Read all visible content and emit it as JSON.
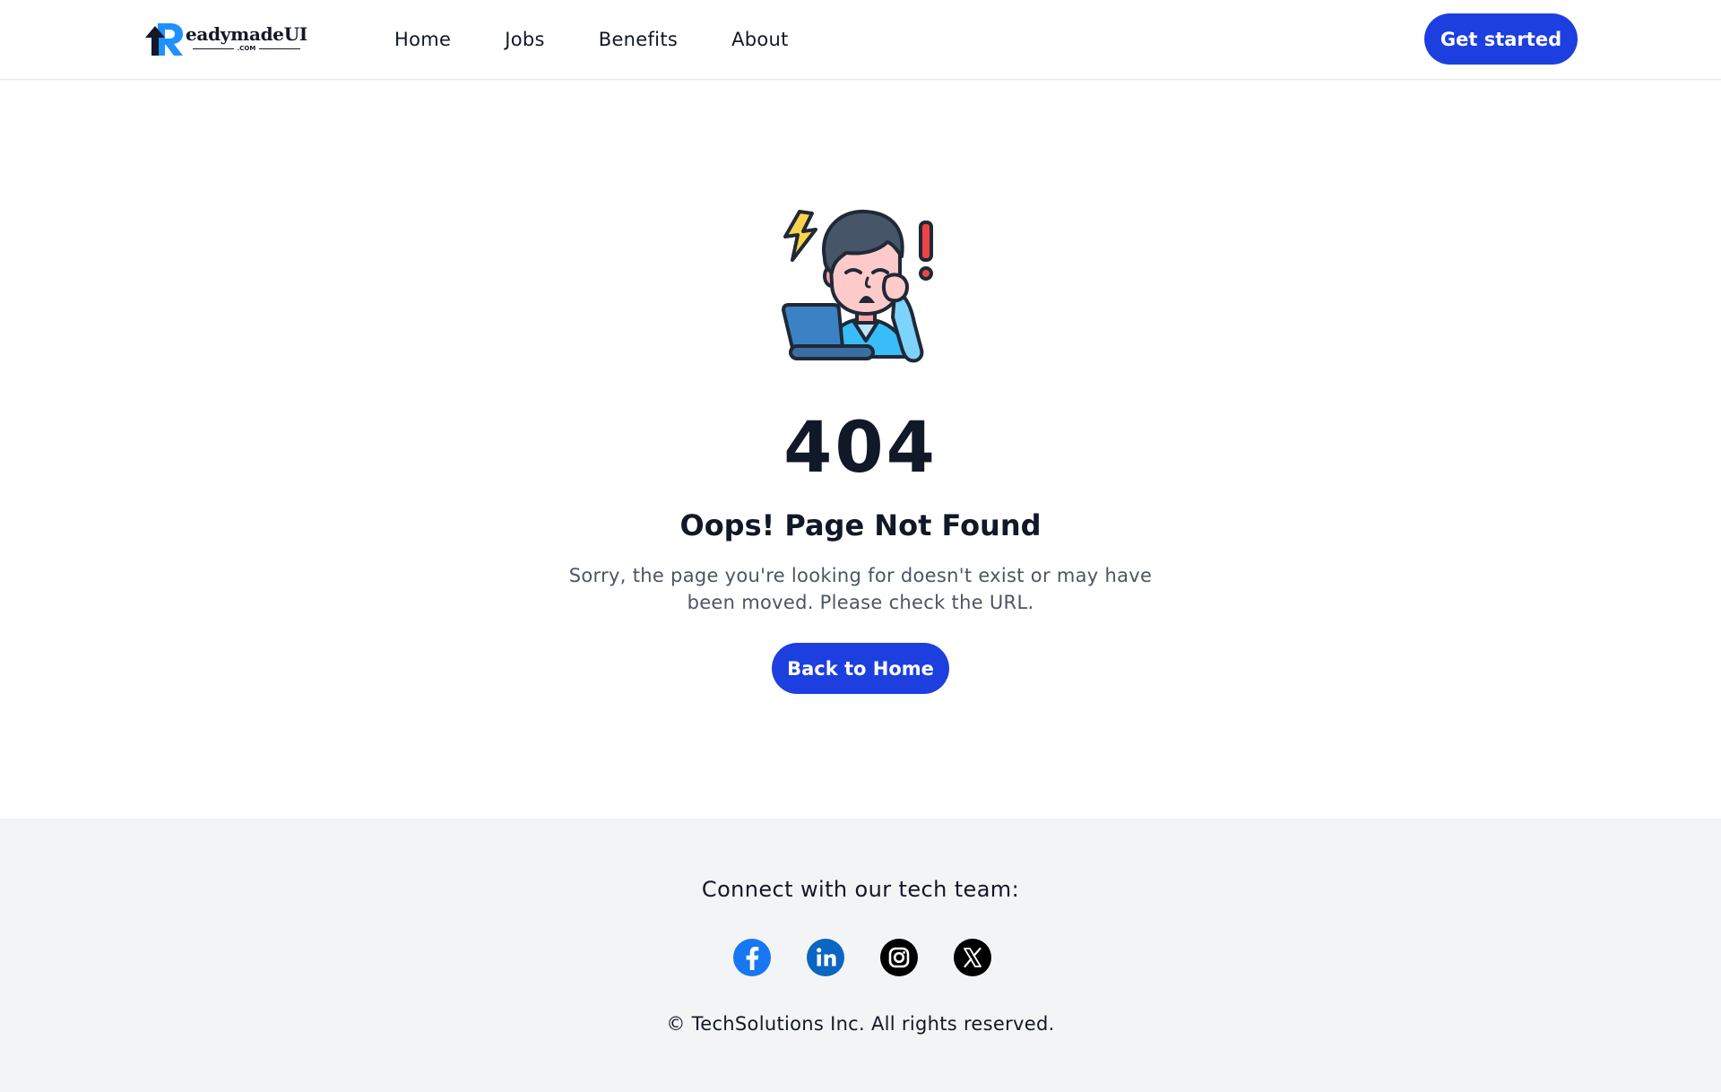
{
  "header": {
    "logo": {
      "brand": "ReadymadeUI",
      "word": "eadymadeUI",
      "sub": ".COM"
    },
    "nav": [
      {
        "label": "Home"
      },
      {
        "label": "Jobs"
      },
      {
        "label": "Benefits"
      },
      {
        "label": "About"
      }
    ],
    "cta_label": "Get started"
  },
  "main": {
    "illustration_icon": "frustrated-person-laptop-icon",
    "code": "404",
    "title": "Oops! Page Not Found",
    "description": "Sorry, the page you're looking for doesn't exist or may have been moved. Please check the URL.",
    "button_label": "Back to Home"
  },
  "footer": {
    "title": "Connect with our tech team:",
    "socials": [
      {
        "icon": "facebook-icon",
        "color": "#1877f2"
      },
      {
        "icon": "linkedin-icon",
        "color": "#0a66c2"
      },
      {
        "icon": "instagram-icon",
        "color": "#000000"
      },
      {
        "icon": "x-icon",
        "color": "#000000"
      }
    ],
    "copyright": "© TechSolutions Inc. All rights reserved."
  },
  "colors": {
    "accent": "#1d3fe0",
    "text": "#111827",
    "muted": "#4b5563",
    "footer_bg": "#f3f4f6"
  }
}
